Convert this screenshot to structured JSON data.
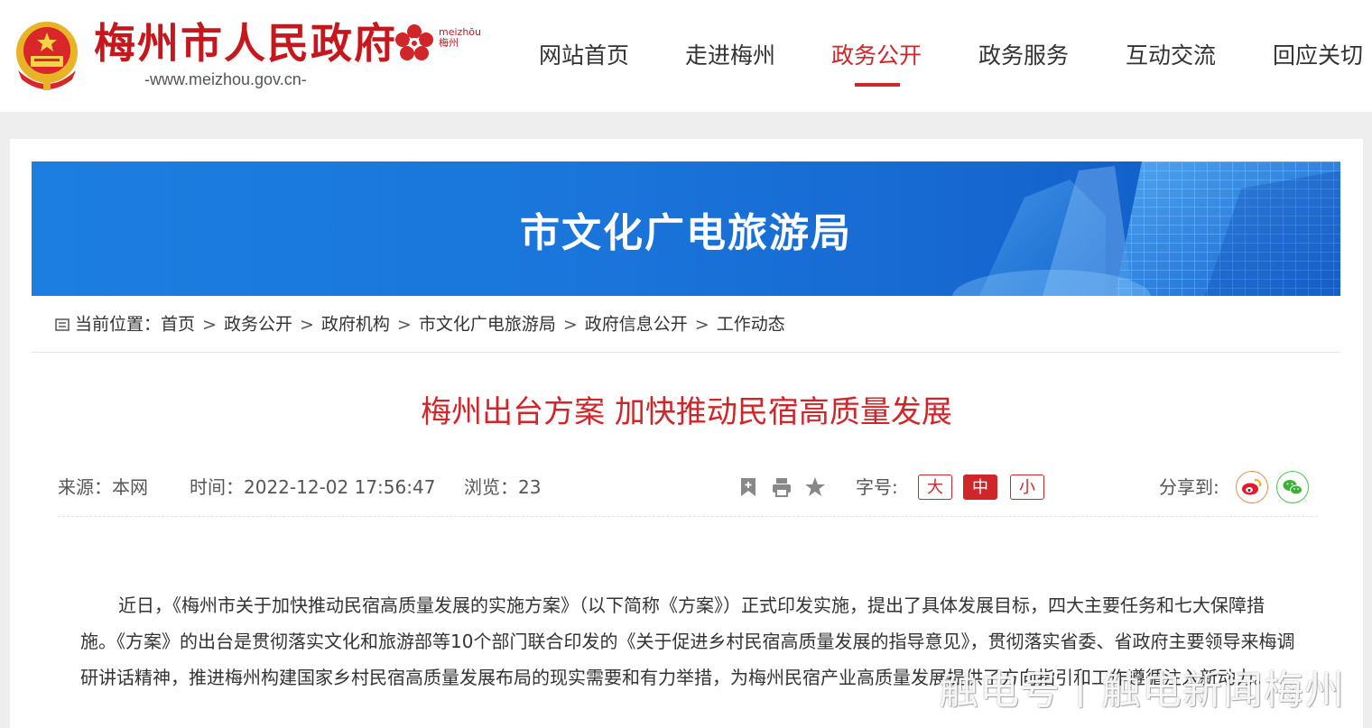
{
  "header": {
    "site_title": "梅州市人民政府",
    "site_url": "-www.meizhou.gov.cn-",
    "city_logo_text_top": "meizhōu",
    "city_logo_text_bottom": "梅州",
    "brand_color": "#c8161d"
  },
  "nav": {
    "items": [
      {
        "label": "网站首页"
      },
      {
        "label": "走进梅州"
      },
      {
        "label": "政务公开",
        "active": true
      },
      {
        "label": "政务服务"
      },
      {
        "label": "互动交流"
      },
      {
        "label": "回应关切"
      }
    ],
    "active_color": "#d0262a"
  },
  "banner": {
    "title": "市文化广电旅游局"
  },
  "breadcrumb": {
    "prefix": "当前位置：",
    "items": [
      "首页",
      "政务公开",
      "政府机构",
      "市文化广电旅游局",
      "政府信息公开",
      "工作动态"
    ],
    "separator": ">"
  },
  "article": {
    "title": "梅州出台方案 加快推动民宿高质量发展",
    "source": "来源：本网",
    "time_label": "时间：",
    "time": "2022-12-02 17:56:47",
    "views_label": "浏览：",
    "views": "23",
    "font_size_label": "字号:",
    "font_sizes": [
      "大",
      "中",
      "小"
    ],
    "font_size_active": "中",
    "share_label": "分享到:",
    "body": "近日，《梅州市关于加快推动民宿高质量发展的实施方案》（以下简称《方案》）正式印发实施，提出了具体发展目标，四大主要任务和七大保障措施。《方案》的出台是贯彻落实文化和旅游部等10个部门联合印发的《关于促进乡村民宿高质量发展的指导意见》，贯彻落实省委、省政府主要领导来梅调研讲话精神，推进梅州构建国家乡村民宿高质量发展布局的现实需要和有力举措，为梅州民宿产业高质量发展提供了方向指引和工作遵循注入新动力。"
  },
  "watermark": "触电号丨触电新闻梅州",
  "icons": [
    "emblem-icon",
    "plum-blossom-logo-icon",
    "list-icon",
    "bookmark-icon",
    "print-icon",
    "star-icon",
    "weibo-icon",
    "wechat-icon"
  ]
}
